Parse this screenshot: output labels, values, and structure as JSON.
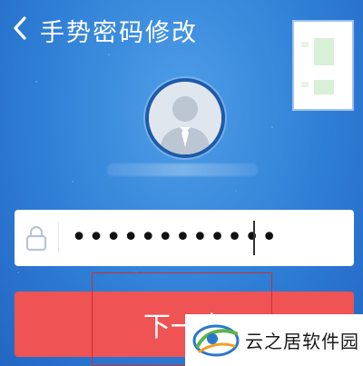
{
  "header": {
    "title": "手势密码修改"
  },
  "password": {
    "value": "••••••••••••"
  },
  "next_button": {
    "label": "下一步"
  },
  "watermark": {
    "text": "云之居软件园"
  },
  "colors": {
    "background": "#2f7fd6",
    "button": "#ef5354",
    "avatar_ring": "#1f5aa8",
    "highlight": "#c8302e"
  },
  "icons": [
    "back-icon",
    "user-avatar-icon",
    "lock-icon",
    "watermark-logo"
  ]
}
